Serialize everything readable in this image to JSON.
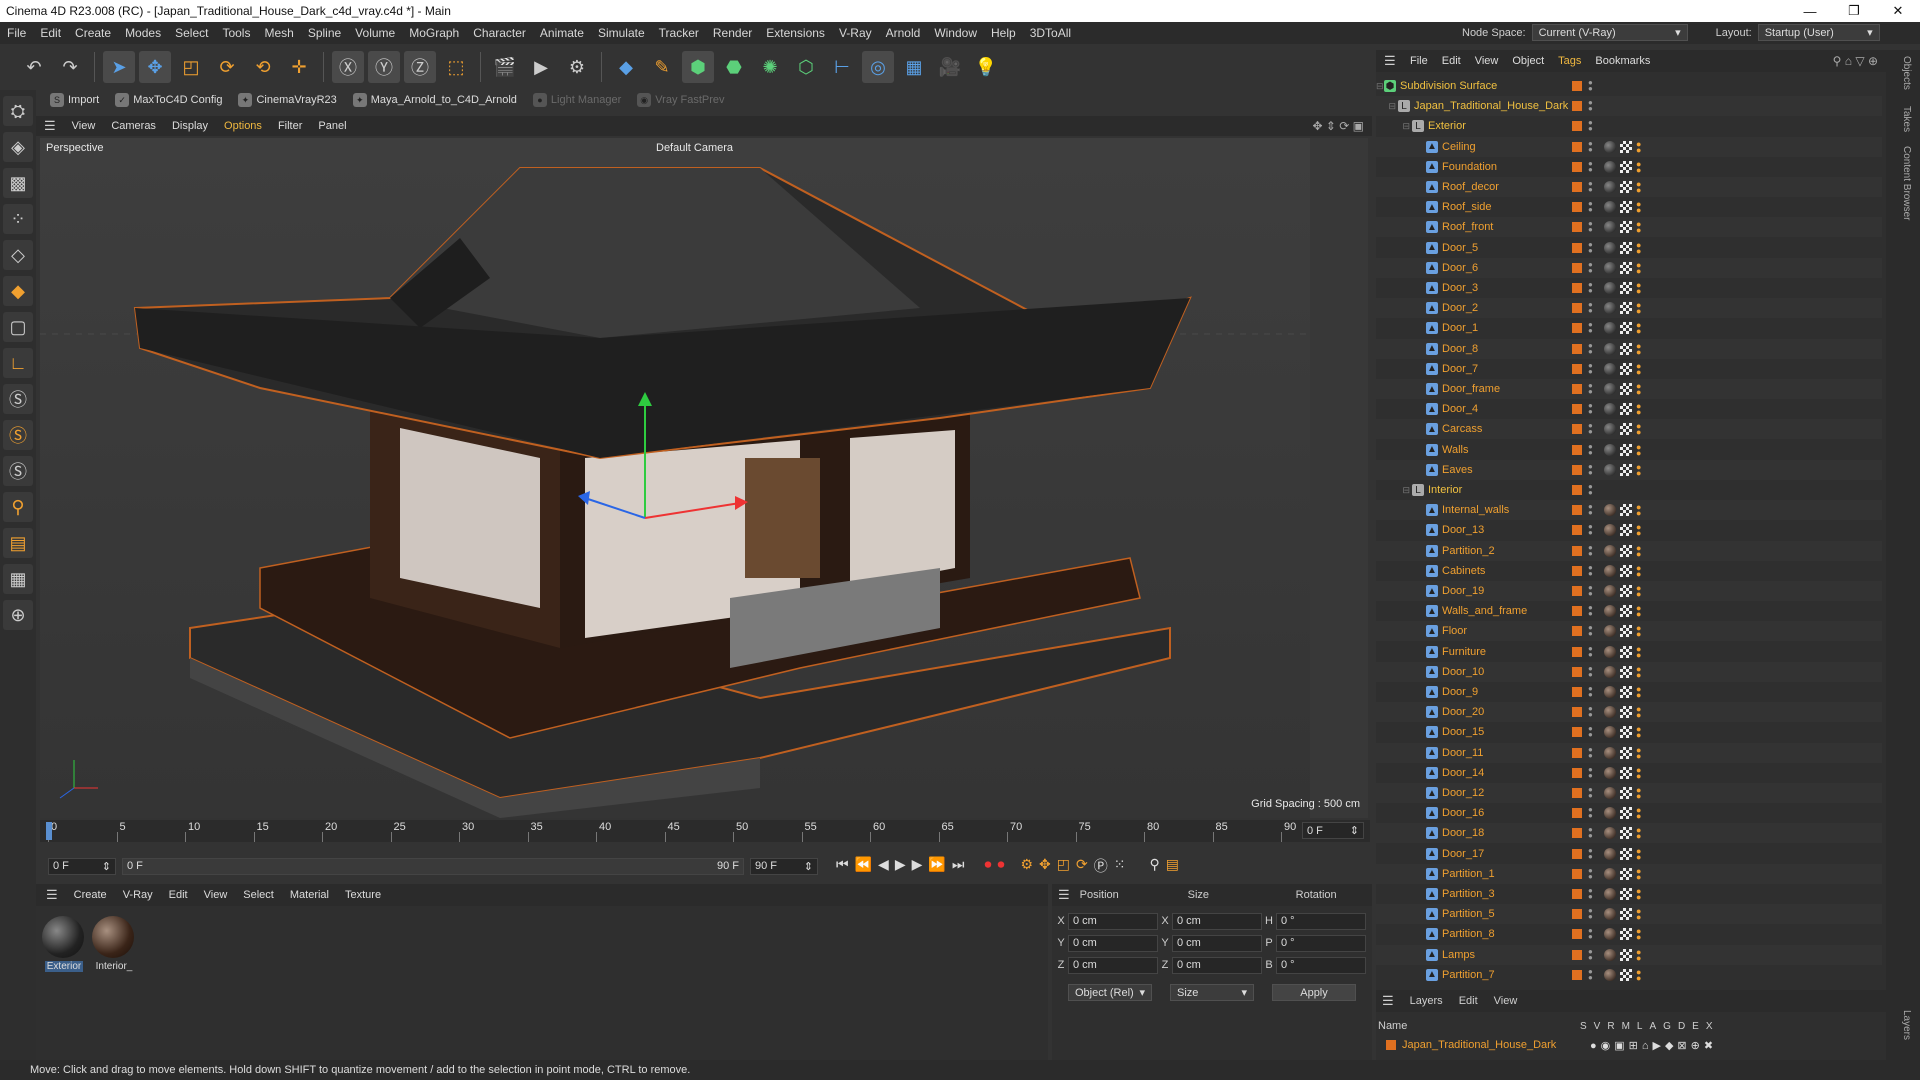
{
  "window": {
    "title": "Cinema 4D R23.008 (RC) - [Japan_Traditional_House_Dark_c4d_vray.c4d *] - Main",
    "controls": [
      "—",
      "❐",
      "✕"
    ]
  },
  "menubar": {
    "items": [
      "File",
      "Edit",
      "Create",
      "Modes",
      "Select",
      "Tools",
      "Mesh",
      "Spline",
      "Volume",
      "MoGraph",
      "Character",
      "Animate",
      "Simulate",
      "Tracker",
      "Render",
      "Extensions",
      "V-Ray",
      "Arnold",
      "Window",
      "Help",
      "3DToAll"
    ],
    "node_space_label": "Node Space:",
    "node_space_value": "Current (V-Ray)",
    "layout_label": "Layout:",
    "layout_value": "Startup (User)"
  },
  "plugins": {
    "import": "Import",
    "maxto": "MaxToC4D Config",
    "cinemavray": "CinemaVrayR23",
    "maya": "Maya_Arnold_to_C4D_Arnold",
    "light": "Light Manager",
    "vrayfast": "Vray FastPrev"
  },
  "viewport": {
    "menu": [
      "View",
      "Cameras",
      "Display",
      "Options",
      "Filter",
      "Panel"
    ],
    "active_menu": "Options",
    "view_name": "Perspective",
    "camera": "Default Camera",
    "grid_spacing": "Grid Spacing : 500 cm"
  },
  "timeline": {
    "ticks": [
      "0",
      "5",
      "10",
      "15",
      "20",
      "25",
      "30",
      "35",
      "40",
      "45",
      "50",
      "55",
      "60",
      "65",
      "70",
      "75",
      "80",
      "85",
      "90"
    ],
    "current_frame_field": "0 F",
    "start_field": "0 F",
    "min_field": "0 F",
    "max_label": "90 F",
    "end_field": "90 F"
  },
  "material_panel": {
    "menu": [
      "Create",
      "V-Ray",
      "Edit",
      "View",
      "Select",
      "Material",
      "Texture"
    ],
    "materials": [
      "Exterior",
      "Interior_"
    ]
  },
  "coords": {
    "headers": [
      "Position",
      "Size",
      "Rotation"
    ],
    "rows": [
      {
        "axis": "X",
        "pos": "0 cm",
        "size_axis": "X",
        "size": "0 cm",
        "rot_axis": "H",
        "rot": "0 °"
      },
      {
        "axis": "Y",
        "pos": "0 cm",
        "size_axis": "Y",
        "size": "0 cm",
        "rot_axis": "P",
        "rot": "0 °"
      },
      {
        "axis": "Z",
        "pos": "0 cm",
        "size_axis": "Z",
        "size": "0 cm",
        "rot_axis": "B",
        "rot": "0 °"
      }
    ],
    "mode": "Object (Rel)",
    "size_mode": "Size",
    "apply": "Apply"
  },
  "status": "Move: Click and drag to move elements. Hold down SHIFT to quantize movement / add to the selection in point mode, CTRL to remove.",
  "object_manager": {
    "menu": [
      "File",
      "Edit",
      "View",
      "Object",
      "Tags",
      "Bookmarks"
    ],
    "active_menu": "Tags",
    "root": "Subdivision Surface",
    "house": "Japan_Traditional_House_Dark",
    "exterior_group": "Exterior",
    "exterior_items": [
      "Ceiling",
      "Foundation",
      "Roof_decor",
      "Roof_side",
      "Roof_front",
      "Door_5",
      "Door_6",
      "Door_3",
      "Door_2",
      "Door_1",
      "Door_8",
      "Door_7",
      "Door_frame",
      "Door_4",
      "Carcass",
      "Walls",
      "Eaves"
    ],
    "interior_group": "Interior",
    "interior_items": [
      "Internal_walls",
      "Door_13",
      "Partition_2",
      "Cabinets",
      "Door_19",
      "Walls_and_frame",
      "Floor",
      "Furniture",
      "Door_10",
      "Door_9",
      "Door_20",
      "Door_15",
      "Door_11",
      "Door_14",
      "Door_12",
      "Door_16",
      "Door_18",
      "Door_17",
      "Partition_1",
      "Partition_3",
      "Partition_5",
      "Partition_8",
      "Lamps",
      "Partition_7"
    ]
  },
  "layers": {
    "menu": [
      "Layers",
      "Edit",
      "View"
    ],
    "name_header": "Name",
    "flags": [
      "S",
      "V",
      "R",
      "M",
      "L",
      "A",
      "G",
      "D",
      "E",
      "X"
    ],
    "layer_name": "Japan_Traditional_House_Dark"
  },
  "right_tabs": [
    "Objects",
    "Takes",
    "Content Browser",
    "Layers"
  ]
}
